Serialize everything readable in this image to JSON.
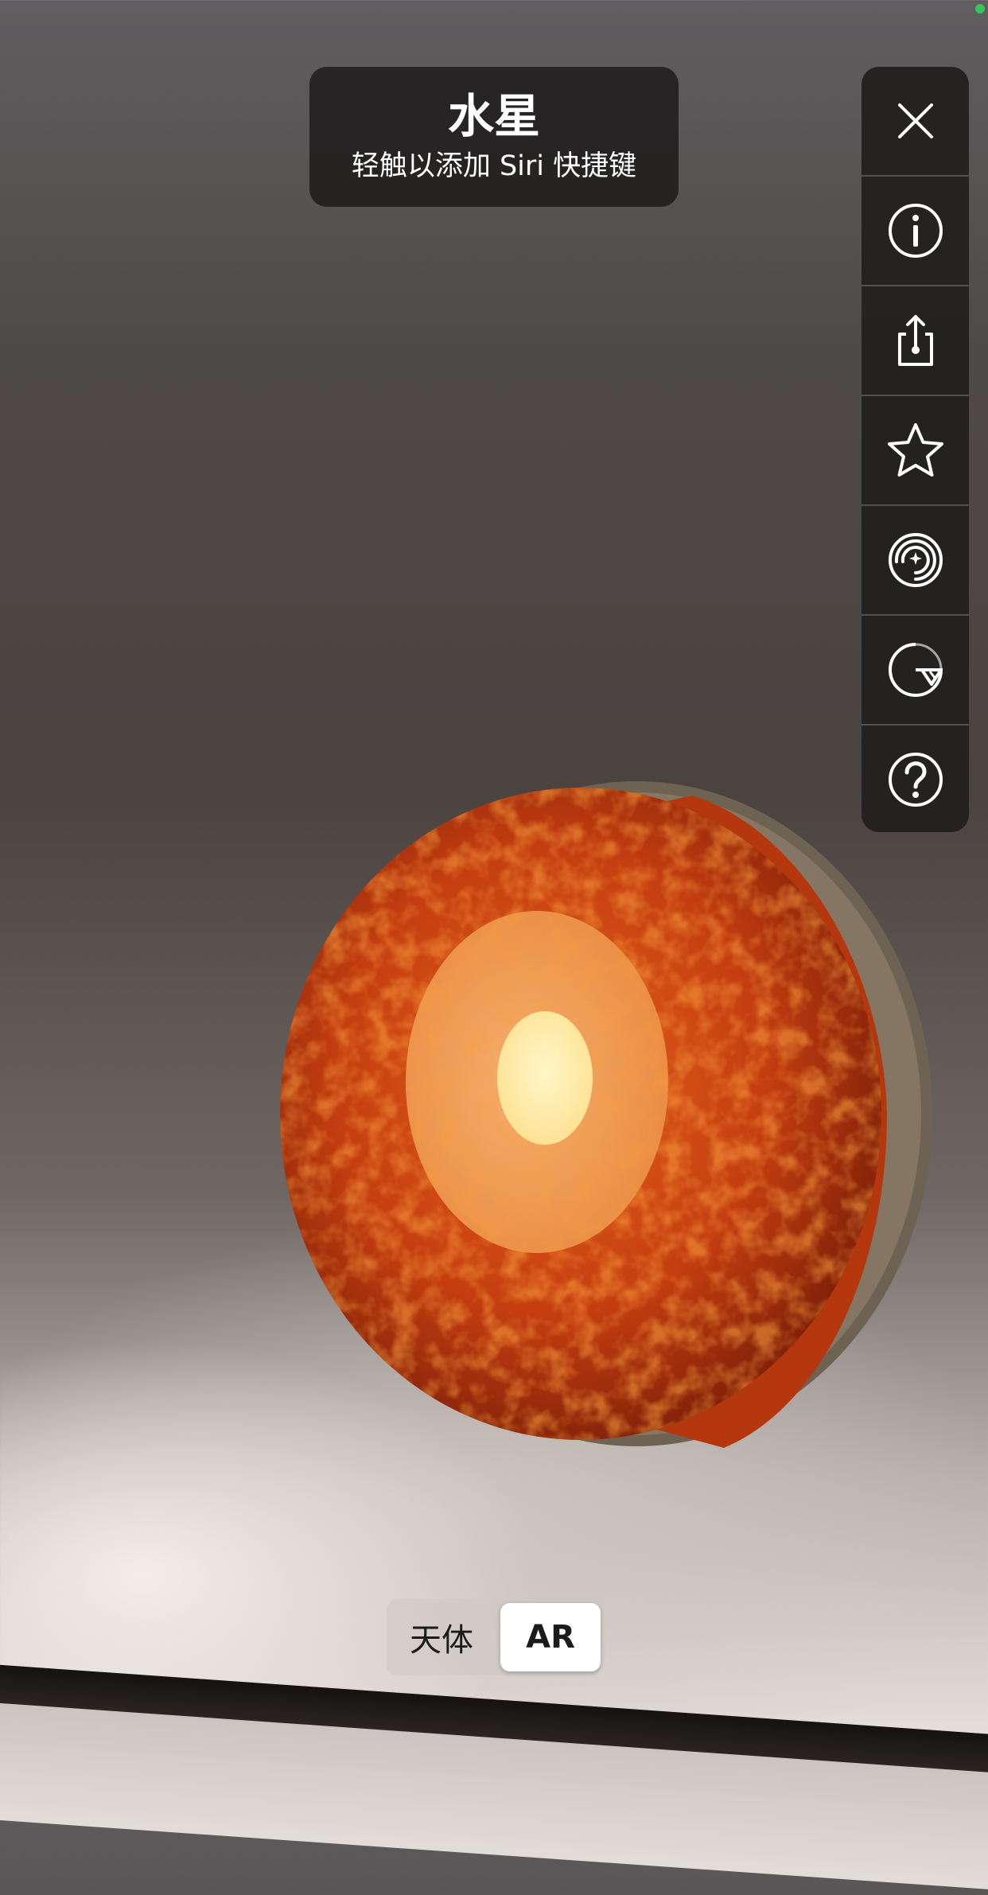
{
  "status": {
    "indicator_color": "#34c759"
  },
  "header": {
    "title": "水星",
    "subtitle": "轻触以添加 Siri 快捷键"
  },
  "toolbar": {
    "items": [
      {
        "icon": "close-icon"
      },
      {
        "icon": "info-icon"
      },
      {
        "icon": "share-icon"
      },
      {
        "icon": "star-icon"
      },
      {
        "icon": "orbit-icon"
      },
      {
        "icon": "cross-section-icon"
      },
      {
        "icon": "help-icon"
      }
    ]
  },
  "view_toggle": {
    "options": [
      "天体",
      "AR"
    ],
    "selected": "AR"
  },
  "colors": {
    "panel": "#22201f",
    "crust": "#7a6a58",
    "mantle": "#c94a12",
    "outer_core": "#f0a060",
    "inner_core": "#ffe9a0"
  }
}
